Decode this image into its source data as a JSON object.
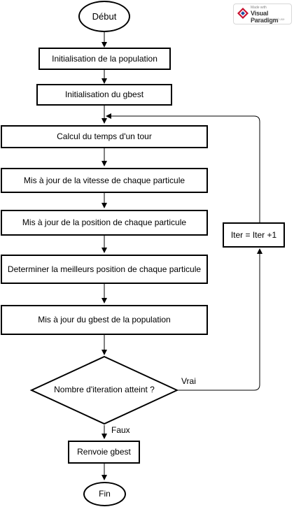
{
  "badge": {
    "made_with": "Made with",
    "brand": "Visual Paradigm",
    "note": "For non-commercial use"
  },
  "nodes": {
    "start": "Début",
    "init_population": "Initialisation de la population",
    "init_gbest": "Initialisation du gbest",
    "calc_tour_time": "Calcul du temps d'un tour",
    "update_velocity": "Mis à jour de la vitesse de chaque particule",
    "update_position": "Mis à jour de la position de chaque particule",
    "determine_best": "Determiner la meilleurs position de chaque particule",
    "update_gbest": "Mis à jour du gbest de la population",
    "decision": "Nombre d'iteration atteint ?",
    "return_gbest": "Renvoie gbest",
    "end": "Fin",
    "iter_increment": "Iter = Iter +1"
  },
  "edges": {
    "yes_label": "Vrai",
    "no_label": "Faux"
  }
}
